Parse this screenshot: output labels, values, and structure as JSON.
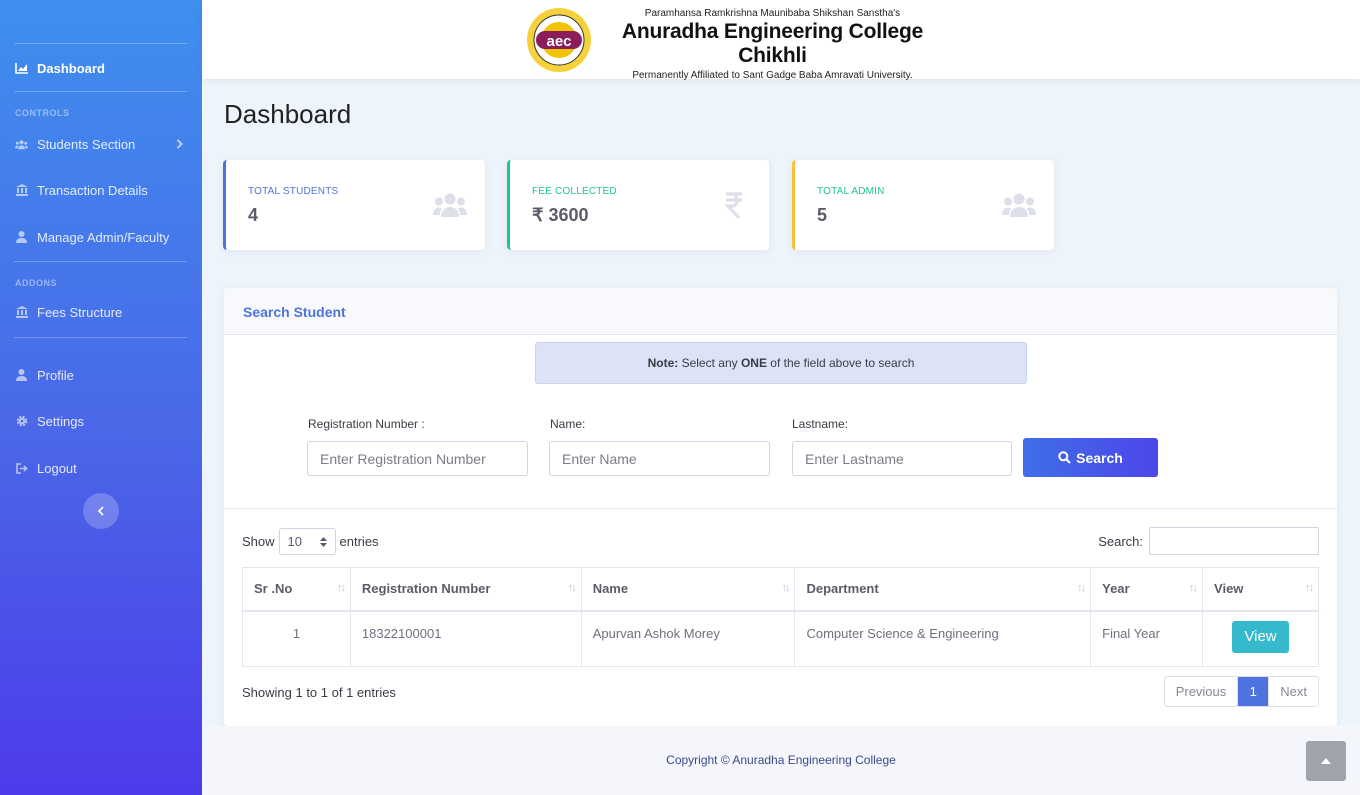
{
  "sidebar": {
    "active_item": "Dashboard",
    "headings": {
      "controls": "CONTROLS",
      "addons": "ADDONS"
    },
    "items": [
      {
        "label": "Dashboard",
        "icon": "chart-area-icon"
      },
      {
        "label": "Students Section",
        "icon": "users-icon"
      },
      {
        "label": "Transaction Details",
        "icon": "bank-icon"
      },
      {
        "label": "Manage Admin/Faculty",
        "icon": "user-icon"
      },
      {
        "label": "Fees Structure",
        "icon": "bank-icon"
      },
      {
        "label": "Profile",
        "icon": "user-icon"
      },
      {
        "label": "Settings",
        "icon": "gear-icon"
      },
      {
        "label": "Logout",
        "icon": "sign-out-icon"
      }
    ]
  },
  "header": {
    "logo_text": "aec",
    "society": "Paramhansa Ramkrishna Maunibaba Shikshan Sanstha's",
    "college_name": "Anuradha Engineering College Chikhli",
    "affiliation": "Permanently Affiliated to Sant Gadge Baba Amravati University."
  },
  "page_title": "Dashboard",
  "cards": [
    {
      "label": "TOTAL STUDENTS",
      "value": "4",
      "accent": "#4e73df",
      "icon": "users-icon"
    },
    {
      "label": "FEE COLLECTED",
      "value": "₹ 3600",
      "accent": "#1cc88a",
      "icon": "rupee-icon"
    },
    {
      "label": "TOTAL ADMIN",
      "value": "5",
      "accent": "#f6c23e",
      "icon": "users-icon"
    }
  ],
  "search_panel": {
    "title": "Search Student",
    "note_prefix": "Note:",
    "note_middle": " Select any ",
    "note_bold": "ONE",
    "note_suffix": " of the field above to search",
    "fields": {
      "registration": {
        "label": "Registration Number :",
        "placeholder": "Enter Registration Number"
      },
      "name": {
        "label": "Name:",
        "placeholder": "Enter Name"
      },
      "lastname": {
        "label": "Lastname:",
        "placeholder": "Enter Lastname"
      }
    },
    "search_button": "Search"
  },
  "table": {
    "show_label": "Show",
    "entries_label": "entries",
    "page_length": "10",
    "search_label": "Search:",
    "columns": [
      "Sr .No",
      "Registration Number",
      "Name",
      "Department",
      "Year",
      "View"
    ],
    "rows": [
      {
        "sr": "1",
        "reg": "18322100001",
        "name": "Apurvan Ashok Morey",
        "dept": "Computer Science & Engineering",
        "year": "Final Year",
        "view": "View"
      }
    ],
    "info": "Showing 1 to 1 of 1 entries",
    "pagination": {
      "previous": "Previous",
      "current": "1",
      "next": "Next"
    }
  },
  "footer": {
    "copyright": "Copyright © Anuradha Engineering College"
  },
  "colors": {
    "primary": "#4e73df",
    "success": "#1cc88a",
    "warning": "#f6c23e",
    "info": "#36b9cc"
  }
}
